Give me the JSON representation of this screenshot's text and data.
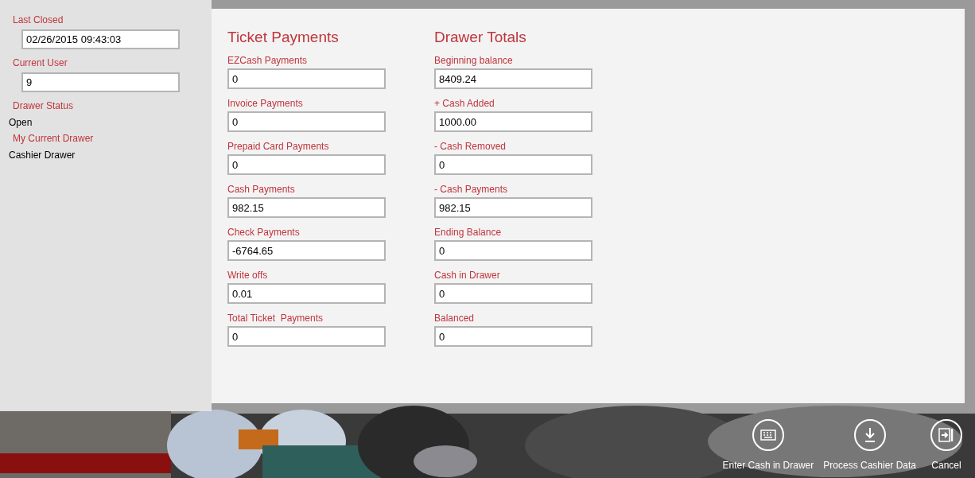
{
  "status_panel": [
    {
      "kind": "field",
      "label": "Last Closed",
      "value": "02/26/2015 09:43:03"
    },
    {
      "kind": "field",
      "label": "Current User",
      "value": "9"
    },
    {
      "kind": "text",
      "label": "Drawer Status",
      "value": "Open"
    },
    {
      "kind": "text",
      "label": "My Current Drawer",
      "value": "Cashier Drawer"
    }
  ],
  "sections": [
    {
      "title": "Ticket Payments",
      "fields": [
        {
          "label": "EZCash Payments",
          "value": "0"
        },
        {
          "label": "Invoice Payments",
          "value": "0"
        },
        {
          "label": "Prepaid Card Payments",
          "value": "0"
        },
        {
          "label": "Cash Payments",
          "value": "982.15"
        },
        {
          "label": "Check Payments",
          "value": "-6764.65"
        },
        {
          "label": "Write offs",
          "value": "0.01"
        },
        {
          "label": "Total Ticket  Payments",
          "value": "0"
        }
      ]
    },
    {
      "title": "Drawer Totals",
      "fields": [
        {
          "label": "Beginning balance",
          "value": "8409.24"
        },
        {
          "label": "+ Cash Added",
          "value": "1000.00"
        },
        {
          "label": "- Cash Removed",
          "value": "0"
        },
        {
          "label": "- Cash Payments",
          "value": "982.15"
        },
        {
          "label": "Ending Balance",
          "value": "0"
        },
        {
          "label": "Cash in Drawer",
          "value": "0"
        },
        {
          "label": "Balanced",
          "value": "0"
        }
      ]
    }
  ],
  "app_bar": [
    {
      "kind": "keyboard",
      "label": "Enter Cash in Drawer"
    },
    {
      "kind": "download",
      "label": "Process Cashier Data"
    },
    {
      "kind": "exit",
      "label": "Cancel"
    }
  ]
}
